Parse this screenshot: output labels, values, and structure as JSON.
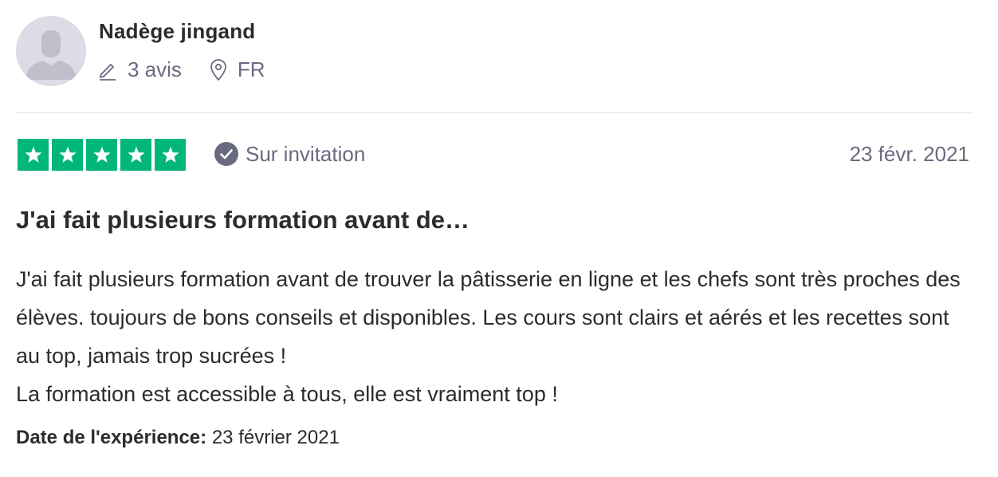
{
  "reviewer": {
    "name": "Nadège jingand",
    "reviews_count": "3 avis",
    "country": "FR",
    "avatar_icon": "user-silhouette-icon"
  },
  "rating": {
    "stars": 5,
    "max_stars": 5,
    "color": "#00b67a",
    "invitation_label": "Sur invitation",
    "date": "23 févr. 2021"
  },
  "review": {
    "title": "J'ai fait plusieurs formation avant de…",
    "text": "J'ai fait plusieurs formation avant de trouver la pâtisserie en ligne et les chefs sont très proches des élèves. toujours de bons conseils et disponibles. Les cours sont clairs et aérés et les recettes sont au top, jamais trop sucrées !\nLa formation est accessible à tous, elle est vraiment top !",
    "experience_label": "Date de l'expérience:",
    "experience_date": "23 février 2021"
  },
  "icons": {
    "reviews": "pencil-icon",
    "location": "location-pin-icon",
    "invitation": "check-circle-icon",
    "star": "star-icon"
  },
  "colors": {
    "star_green": "#00b67a",
    "muted_text": "#696a80",
    "divider": "#dcdce6"
  }
}
